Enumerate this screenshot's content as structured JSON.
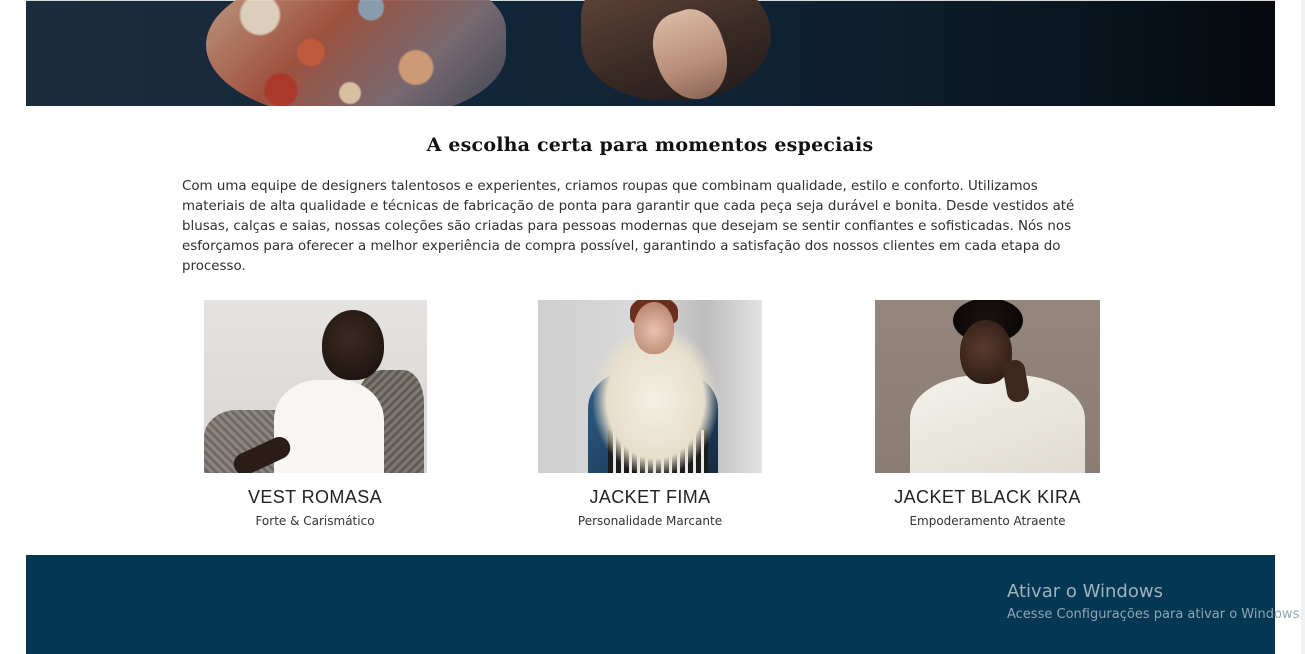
{
  "section": {
    "title": "A escolha certa para momentos especiais",
    "description": "Com uma equipe de designers talentosos e experientes, criamos roupas que combinam qualidade, estilo e conforto. Utilizamos materiais de alta qualidade e técnicas de fabricação de ponta para garantir que cada peça seja durável e bonita. Desde vestidos até blusas, calças e saias, nossas coleções são criadas para pessoas modernas que desejam se sentir confiantes e sofisticadas. Nós nos esforçamos para oferecer a melhor experiência de compra possível, garantindo a satisfação dos nossos clientes em cada etapa do processo."
  },
  "products": [
    {
      "name": "VEST ROMASA",
      "tagline": "Forte & Carismático"
    },
    {
      "name": "JACKET FIMA",
      "tagline": "Personalidade Marcante"
    },
    {
      "name": "JACKET BLACK KIRA",
      "tagline": "Empoderamento Atraente"
    }
  ],
  "windows_watermark": {
    "title": "Ativar o Windows",
    "subtitle": "Acesse Configurações para ativar o Windows."
  },
  "colors": {
    "footer": "#033752",
    "hero": "#13273a"
  }
}
